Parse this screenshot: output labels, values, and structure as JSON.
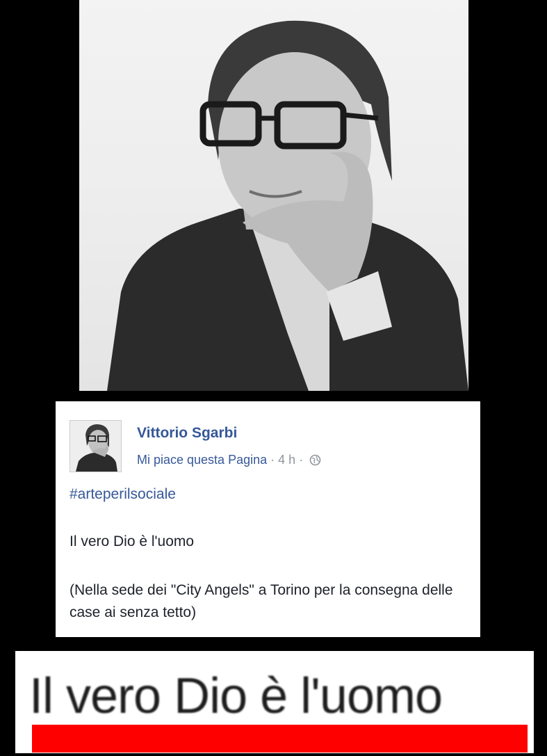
{
  "photo": {
    "description_icon": "portrait-photo"
  },
  "post": {
    "author": "Vittorio Sgarbi",
    "like_page_link": "Mi piace questa Pagina",
    "separator_1": "·",
    "time": "4 h",
    "separator_2": "·",
    "privacy_icon": "globe-icon",
    "hashtag": "#arteperilsociale",
    "text_line_1": "Il vero Dio è l'uomo",
    "text_line_2": "(Nella sede dei \"City Angels\" a Torino per la consegna delle case ai senza tetto)"
  },
  "zoom_banner": {
    "text": "Il vero Dio è l'uomo",
    "underline_color": "#ff0000"
  },
  "colors": {
    "facebook_link": "#365899",
    "meta_gray": "#90949c",
    "text": "#1d2129",
    "background": "#000000"
  }
}
